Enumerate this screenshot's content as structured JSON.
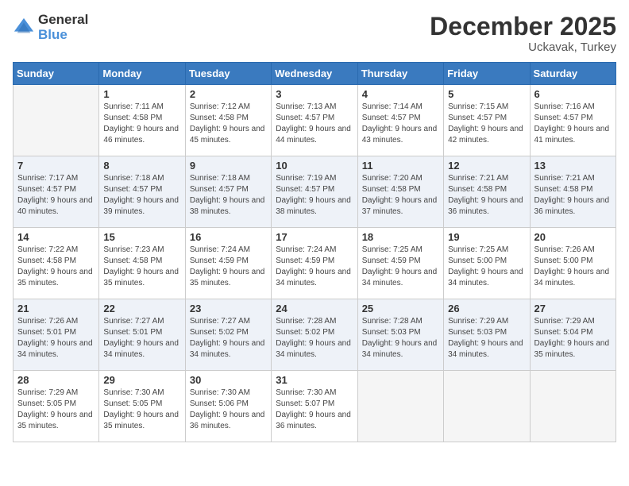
{
  "logo": {
    "general": "General",
    "blue": "Blue"
  },
  "title": {
    "month_year": "December 2025",
    "location": "Uckavak, Turkey"
  },
  "days_of_week": [
    "Sunday",
    "Monday",
    "Tuesday",
    "Wednesday",
    "Thursday",
    "Friday",
    "Saturday"
  ],
  "weeks": [
    [
      {
        "day": "",
        "sunrise": "",
        "sunset": "",
        "daylight": ""
      },
      {
        "day": "1",
        "sunrise": "Sunrise: 7:11 AM",
        "sunset": "Sunset: 4:58 PM",
        "daylight": "Daylight: 9 hours and 46 minutes."
      },
      {
        "day": "2",
        "sunrise": "Sunrise: 7:12 AM",
        "sunset": "Sunset: 4:58 PM",
        "daylight": "Daylight: 9 hours and 45 minutes."
      },
      {
        "day": "3",
        "sunrise": "Sunrise: 7:13 AM",
        "sunset": "Sunset: 4:57 PM",
        "daylight": "Daylight: 9 hours and 44 minutes."
      },
      {
        "day": "4",
        "sunrise": "Sunrise: 7:14 AM",
        "sunset": "Sunset: 4:57 PM",
        "daylight": "Daylight: 9 hours and 43 minutes."
      },
      {
        "day": "5",
        "sunrise": "Sunrise: 7:15 AM",
        "sunset": "Sunset: 4:57 PM",
        "daylight": "Daylight: 9 hours and 42 minutes."
      },
      {
        "day": "6",
        "sunrise": "Sunrise: 7:16 AM",
        "sunset": "Sunset: 4:57 PM",
        "daylight": "Daylight: 9 hours and 41 minutes."
      }
    ],
    [
      {
        "day": "7",
        "sunrise": "Sunrise: 7:17 AM",
        "sunset": "Sunset: 4:57 PM",
        "daylight": "Daylight: 9 hours and 40 minutes."
      },
      {
        "day": "8",
        "sunrise": "Sunrise: 7:18 AM",
        "sunset": "Sunset: 4:57 PM",
        "daylight": "Daylight: 9 hours and 39 minutes."
      },
      {
        "day": "9",
        "sunrise": "Sunrise: 7:18 AM",
        "sunset": "Sunset: 4:57 PM",
        "daylight": "Daylight: 9 hours and 38 minutes."
      },
      {
        "day": "10",
        "sunrise": "Sunrise: 7:19 AM",
        "sunset": "Sunset: 4:57 PM",
        "daylight": "Daylight: 9 hours and 38 minutes."
      },
      {
        "day": "11",
        "sunrise": "Sunrise: 7:20 AM",
        "sunset": "Sunset: 4:58 PM",
        "daylight": "Daylight: 9 hours and 37 minutes."
      },
      {
        "day": "12",
        "sunrise": "Sunrise: 7:21 AM",
        "sunset": "Sunset: 4:58 PM",
        "daylight": "Daylight: 9 hours and 36 minutes."
      },
      {
        "day": "13",
        "sunrise": "Sunrise: 7:21 AM",
        "sunset": "Sunset: 4:58 PM",
        "daylight": "Daylight: 9 hours and 36 minutes."
      }
    ],
    [
      {
        "day": "14",
        "sunrise": "Sunrise: 7:22 AM",
        "sunset": "Sunset: 4:58 PM",
        "daylight": "Daylight: 9 hours and 35 minutes."
      },
      {
        "day": "15",
        "sunrise": "Sunrise: 7:23 AM",
        "sunset": "Sunset: 4:58 PM",
        "daylight": "Daylight: 9 hours and 35 minutes."
      },
      {
        "day": "16",
        "sunrise": "Sunrise: 7:24 AM",
        "sunset": "Sunset: 4:59 PM",
        "daylight": "Daylight: 9 hours and 35 minutes."
      },
      {
        "day": "17",
        "sunrise": "Sunrise: 7:24 AM",
        "sunset": "Sunset: 4:59 PM",
        "daylight": "Daylight: 9 hours and 34 minutes."
      },
      {
        "day": "18",
        "sunrise": "Sunrise: 7:25 AM",
        "sunset": "Sunset: 4:59 PM",
        "daylight": "Daylight: 9 hours and 34 minutes."
      },
      {
        "day": "19",
        "sunrise": "Sunrise: 7:25 AM",
        "sunset": "Sunset: 5:00 PM",
        "daylight": "Daylight: 9 hours and 34 minutes."
      },
      {
        "day": "20",
        "sunrise": "Sunrise: 7:26 AM",
        "sunset": "Sunset: 5:00 PM",
        "daylight": "Daylight: 9 hours and 34 minutes."
      }
    ],
    [
      {
        "day": "21",
        "sunrise": "Sunrise: 7:26 AM",
        "sunset": "Sunset: 5:01 PM",
        "daylight": "Daylight: 9 hours and 34 minutes."
      },
      {
        "day": "22",
        "sunrise": "Sunrise: 7:27 AM",
        "sunset": "Sunset: 5:01 PM",
        "daylight": "Daylight: 9 hours and 34 minutes."
      },
      {
        "day": "23",
        "sunrise": "Sunrise: 7:27 AM",
        "sunset": "Sunset: 5:02 PM",
        "daylight": "Daylight: 9 hours and 34 minutes."
      },
      {
        "day": "24",
        "sunrise": "Sunrise: 7:28 AM",
        "sunset": "Sunset: 5:02 PM",
        "daylight": "Daylight: 9 hours and 34 minutes."
      },
      {
        "day": "25",
        "sunrise": "Sunrise: 7:28 AM",
        "sunset": "Sunset: 5:03 PM",
        "daylight": "Daylight: 9 hours and 34 minutes."
      },
      {
        "day": "26",
        "sunrise": "Sunrise: 7:29 AM",
        "sunset": "Sunset: 5:03 PM",
        "daylight": "Daylight: 9 hours and 34 minutes."
      },
      {
        "day": "27",
        "sunrise": "Sunrise: 7:29 AM",
        "sunset": "Sunset: 5:04 PM",
        "daylight": "Daylight: 9 hours and 35 minutes."
      }
    ],
    [
      {
        "day": "28",
        "sunrise": "Sunrise: 7:29 AM",
        "sunset": "Sunset: 5:05 PM",
        "daylight": "Daylight: 9 hours and 35 minutes."
      },
      {
        "day": "29",
        "sunrise": "Sunrise: 7:30 AM",
        "sunset": "Sunset: 5:05 PM",
        "daylight": "Daylight: 9 hours and 35 minutes."
      },
      {
        "day": "30",
        "sunrise": "Sunrise: 7:30 AM",
        "sunset": "Sunset: 5:06 PM",
        "daylight": "Daylight: 9 hours and 36 minutes."
      },
      {
        "day": "31",
        "sunrise": "Sunrise: 7:30 AM",
        "sunset": "Sunset: 5:07 PM",
        "daylight": "Daylight: 9 hours and 36 minutes."
      },
      {
        "day": "",
        "sunrise": "",
        "sunset": "",
        "daylight": ""
      },
      {
        "day": "",
        "sunrise": "",
        "sunset": "",
        "daylight": ""
      },
      {
        "day": "",
        "sunrise": "",
        "sunset": "",
        "daylight": ""
      }
    ]
  ],
  "row_colors": [
    "#ffffff",
    "#eef2f8",
    "#ffffff",
    "#eef2f8",
    "#ffffff"
  ]
}
